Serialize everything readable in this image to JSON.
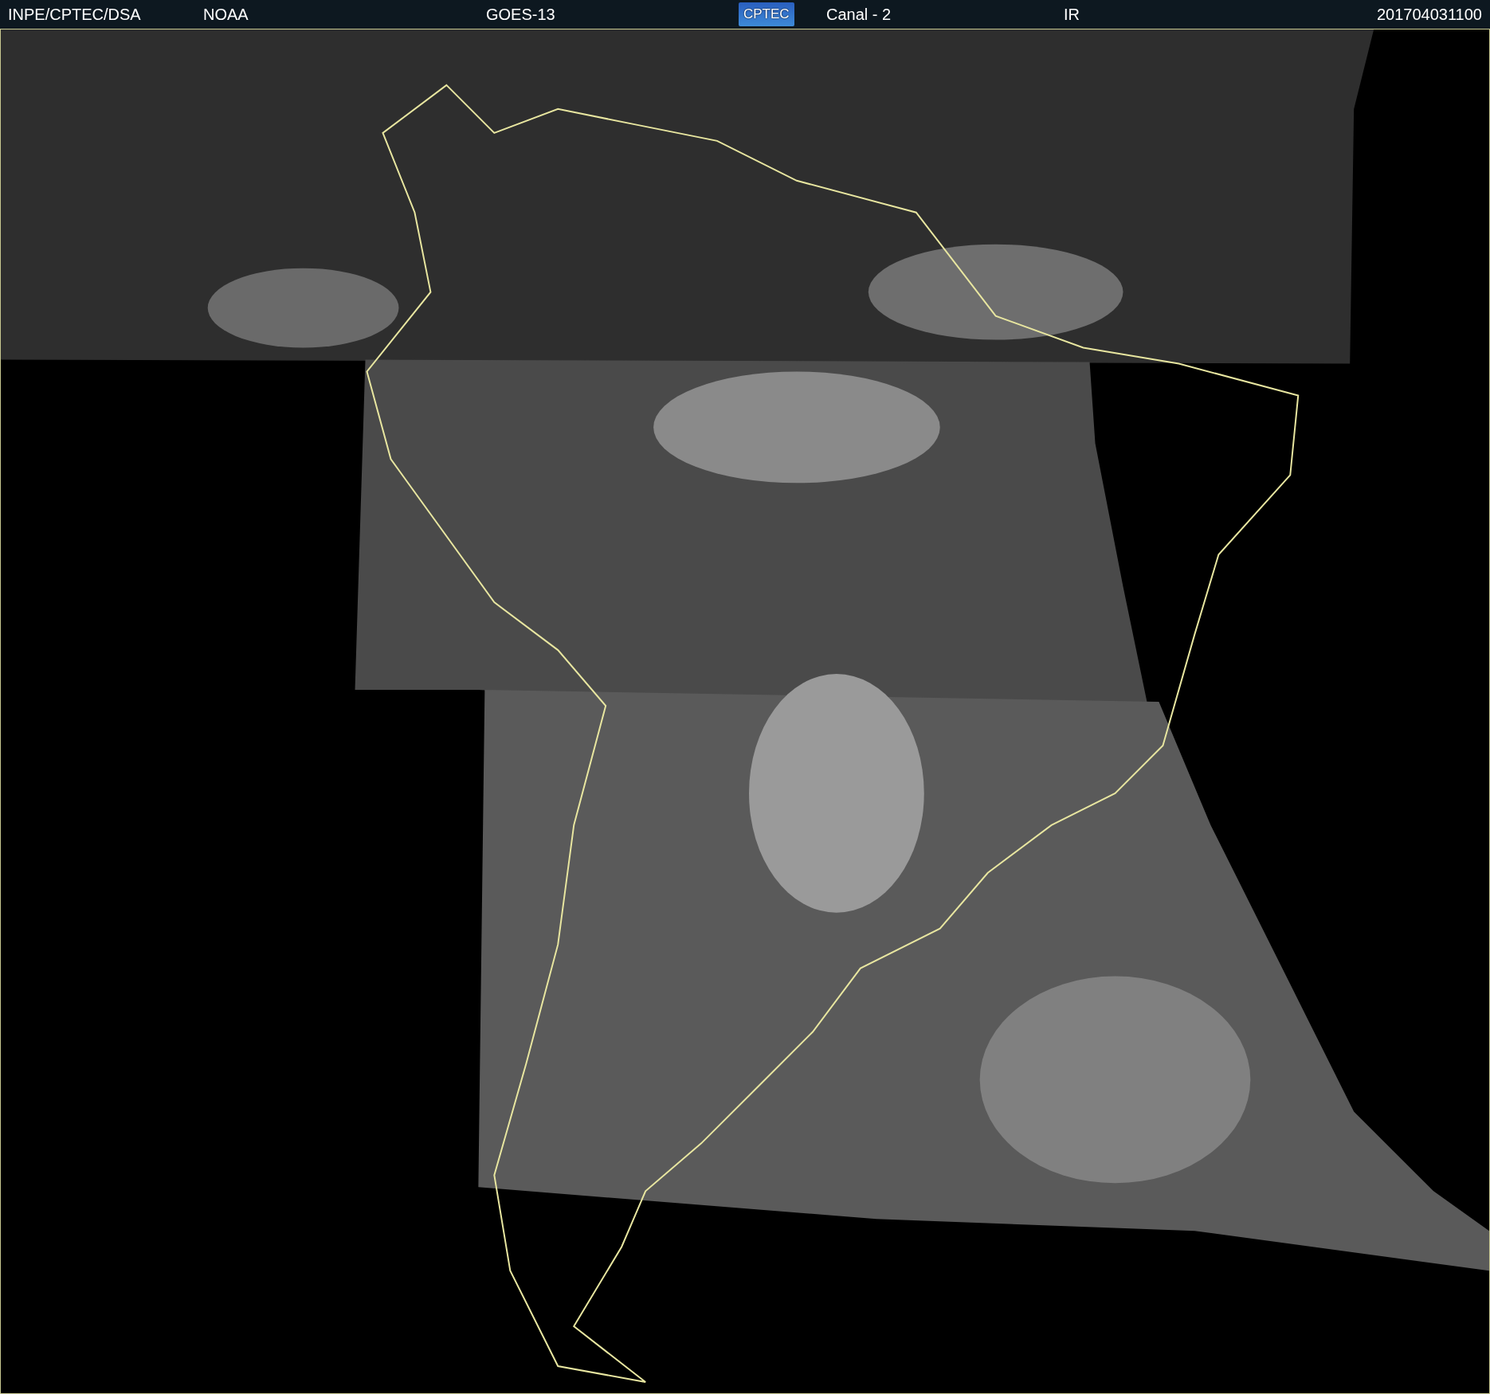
{
  "header": [
    {
      "kind": "text",
      "text": "INPE/CPTEC/DSA"
    },
    {
      "kind": "text",
      "text": "NOAA"
    },
    {
      "kind": "text",
      "text": "GOES-13"
    },
    {
      "kind": "logo",
      "text": "CPTEC"
    },
    {
      "kind": "text",
      "text": "Canal - 2"
    },
    {
      "kind": "text",
      "text": "IR"
    },
    {
      "kind": "text",
      "text": "201704031100"
    }
  ]
}
